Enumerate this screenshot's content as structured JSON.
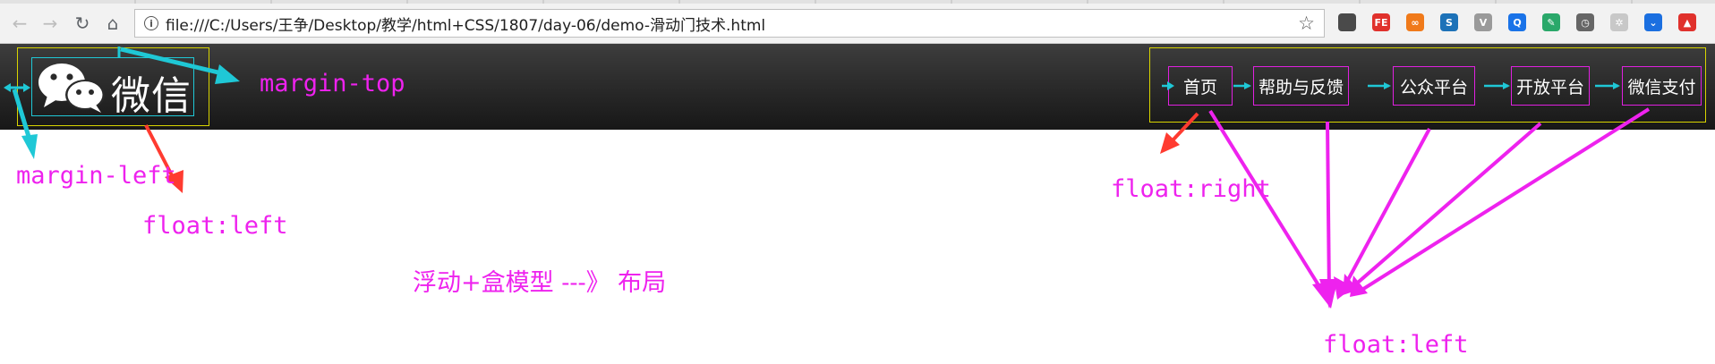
{
  "browser": {
    "url": "file:///C:/Users/王争/Desktop/教学/html+CSS/1807/day-06/demo-滑动门技术.html",
    "info_glyph": "i",
    "star_glyph": "☆",
    "nav_glyphs": {
      "back": "←",
      "forward": "→",
      "reload": "↻",
      "home": "⌂"
    },
    "extensions": [
      {
        "name": "qr-icon",
        "label": "",
        "color": "#4a4a4a"
      },
      {
        "name": "fe-icon",
        "label": "FE",
        "color": "#e0312c"
      },
      {
        "name": "infinity-icon",
        "label": "∞",
        "color": "#f07a1a"
      },
      {
        "name": "s-icon",
        "label": "S",
        "color": "#1d72b8"
      },
      {
        "name": "v-icon",
        "label": "V",
        "color": "#9a9a9a"
      },
      {
        "name": "search-ext-icon",
        "label": "Q",
        "color": "#1a73e8"
      },
      {
        "name": "dropper-icon",
        "label": "✎",
        "color": "#2aa86a"
      },
      {
        "name": "clock-icon",
        "label": "◷",
        "color": "#666666"
      },
      {
        "name": "puzzle-icon",
        "label": "✲",
        "color": "#c8c8c8"
      },
      {
        "name": "pocket-icon",
        "label": "⌄",
        "color": "#1b6fe0"
      },
      {
        "name": "upload-icon",
        "label": "▲",
        "color": "#e0312c"
      }
    ]
  },
  "page": {
    "logo_text": "微信",
    "nav": [
      "首页",
      "帮助与反馈",
      "公众平台",
      "开放平台",
      "微信支付"
    ]
  },
  "annotations": {
    "margin_top": "margin-top",
    "margin_left": "margin-left",
    "float_left_logo": "float:left",
    "float_right_nav": "float:right",
    "layout_note": "浮动+盒模型 ---》 布局",
    "float_left_items": "float:left"
  },
  "colors": {
    "annotation": "#ee22ee",
    "logo_border": "#1fc8d6",
    "container_border": "#d8d400",
    "arrow_red": "#ff3b30",
    "arrow_cyan": "#1fc8d6"
  }
}
